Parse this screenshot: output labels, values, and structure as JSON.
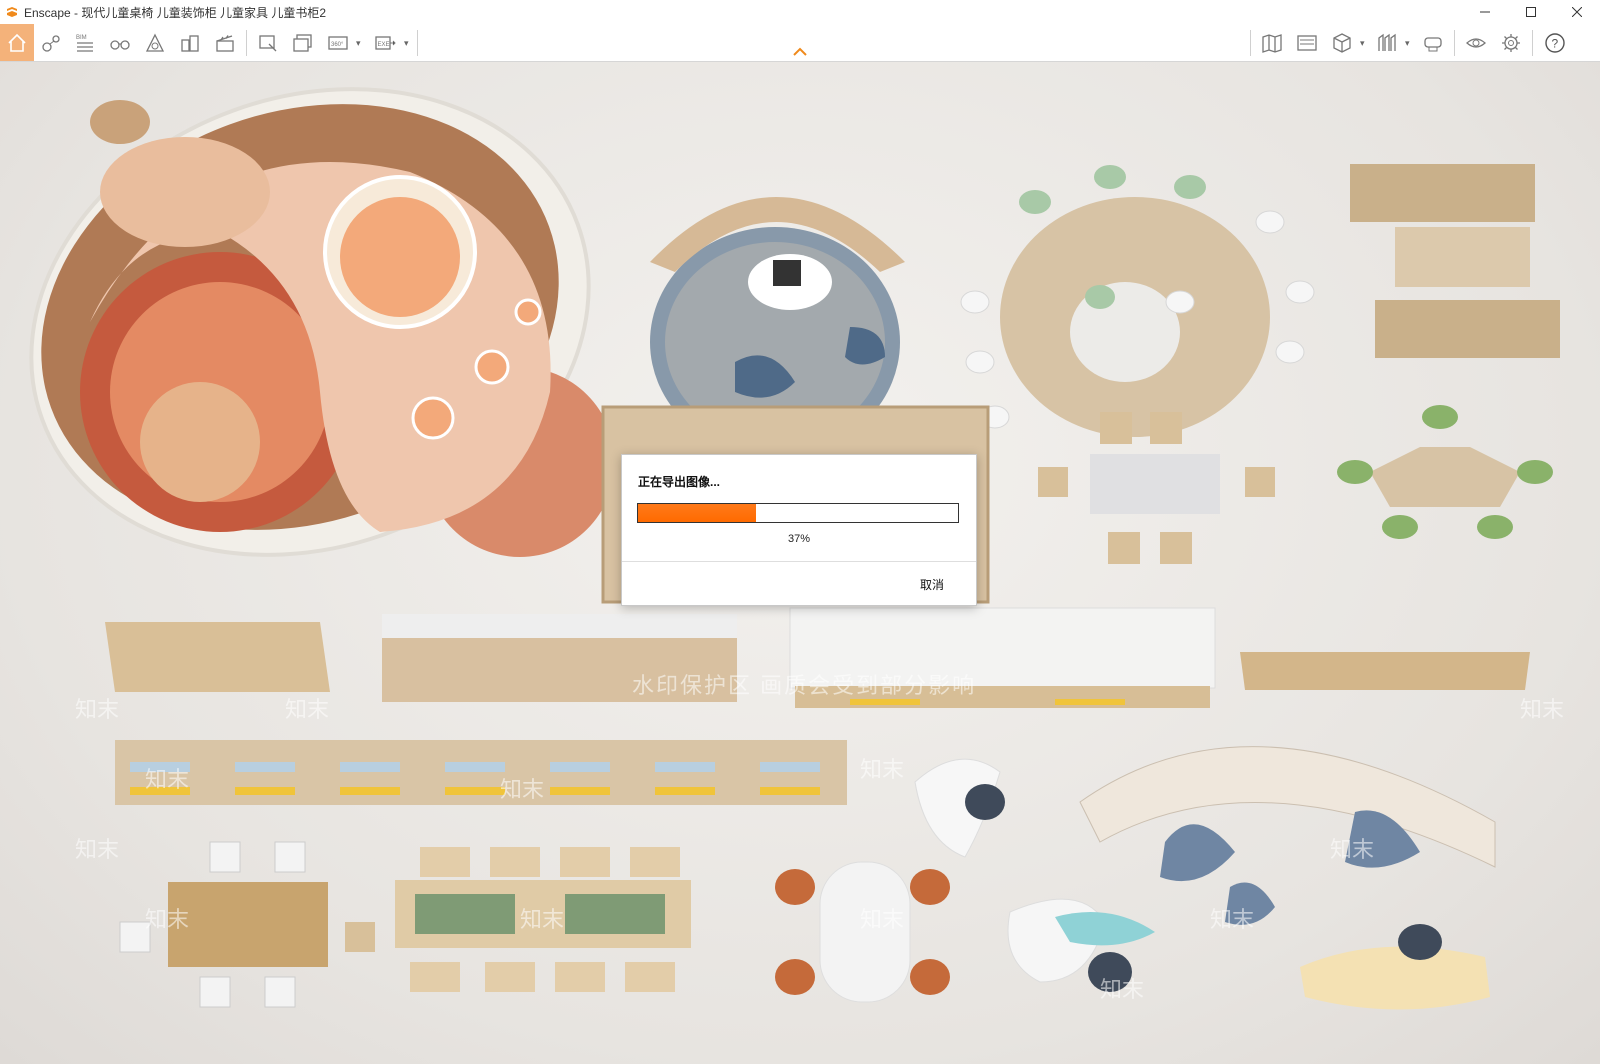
{
  "window": {
    "title": "Enscape - 现代儿童桌椅 儿童装饰柜 儿童家具 儿童书柜2",
    "controls": [
      "minimize-icon",
      "maximize-icon",
      "close-icon"
    ]
  },
  "toolbar": {
    "left_icons": [
      "home-icon",
      "navigation-icon",
      "bim-icon",
      "binoculars-icon",
      "asset-library-icon",
      "buildings-icon",
      "clapper-icon",
      "screenshot-icon",
      "batch-render-icon",
      "panorama-icon",
      "export-icon"
    ],
    "bim_label": "BIM",
    "panorama_label": "360°",
    "export_label": "EXE",
    "right_icons": [
      "map-icon",
      "atmosphere-icon",
      "cube-icon",
      "views-icon",
      "vr-headset-icon",
      "visual-settings-icon",
      "settings-icon",
      "help-icon"
    ],
    "accent": "#f4b27a"
  },
  "scene": {
    "watermark_main": "知末",
    "watermark_note": "水印保护区  画质会受到部分影响"
  },
  "dialog": {
    "title": "正在导出图像...",
    "progress_percent_label": "37%",
    "progress_value": 0.37,
    "cancel_label": "取消",
    "progress_color": "#ff6a00"
  }
}
